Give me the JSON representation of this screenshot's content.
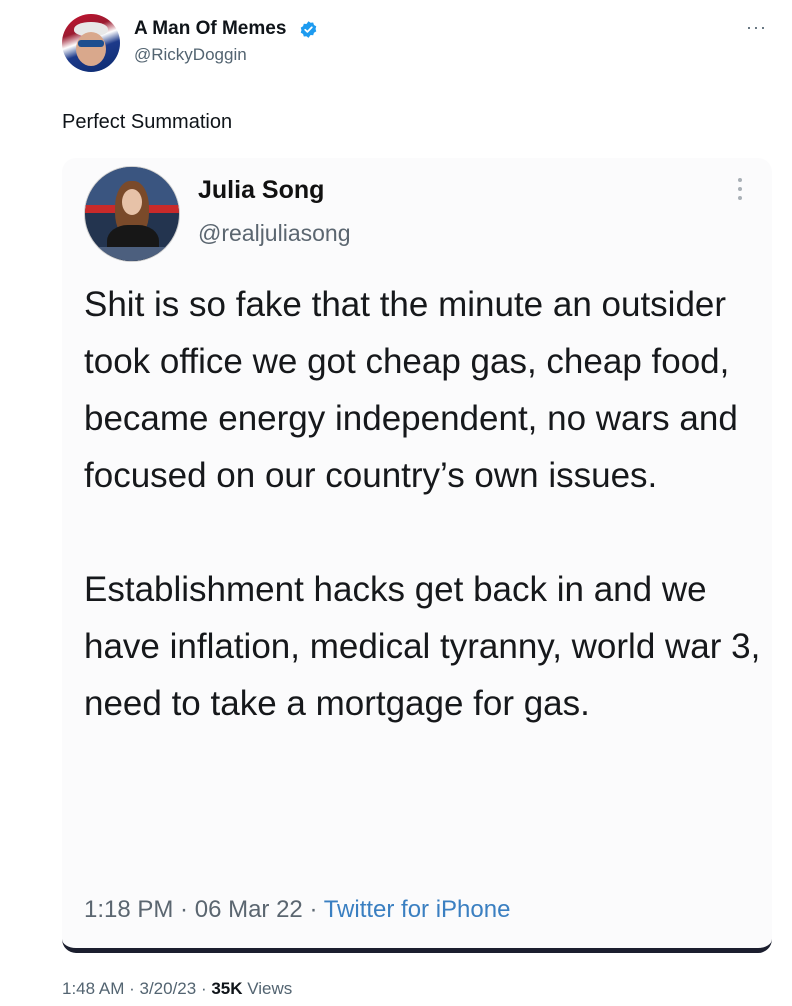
{
  "tweet": {
    "author_name": "A Man Of Memes",
    "author_handle": "@RickyDoggin",
    "text": "Perfect Summation",
    "time": "1:48 AM",
    "date": "3/20/23",
    "views_count": "35K",
    "views_label": "Views",
    "separator": " · ",
    "more_icon": "more-horizontal-icon",
    "verified_color": "#1d9bf0"
  },
  "embedded": {
    "name": "Julia Song",
    "handle": "@realjuliasong",
    "paragraph1": "Shit is so fake that the minute an outsider took office we got cheap gas, cheap food, became energy independent, no wars and focused on our country’s own issues.",
    "paragraph2": "Establishment hacks get back in and we have inflation, medical tyranny, world war 3, need to take a mortgage for gas.",
    "time": "1:18 PM",
    "date": "06 Mar 22",
    "source": "Twitter for iPhone",
    "separator": " · ",
    "link_color": "#3a7fc1"
  }
}
